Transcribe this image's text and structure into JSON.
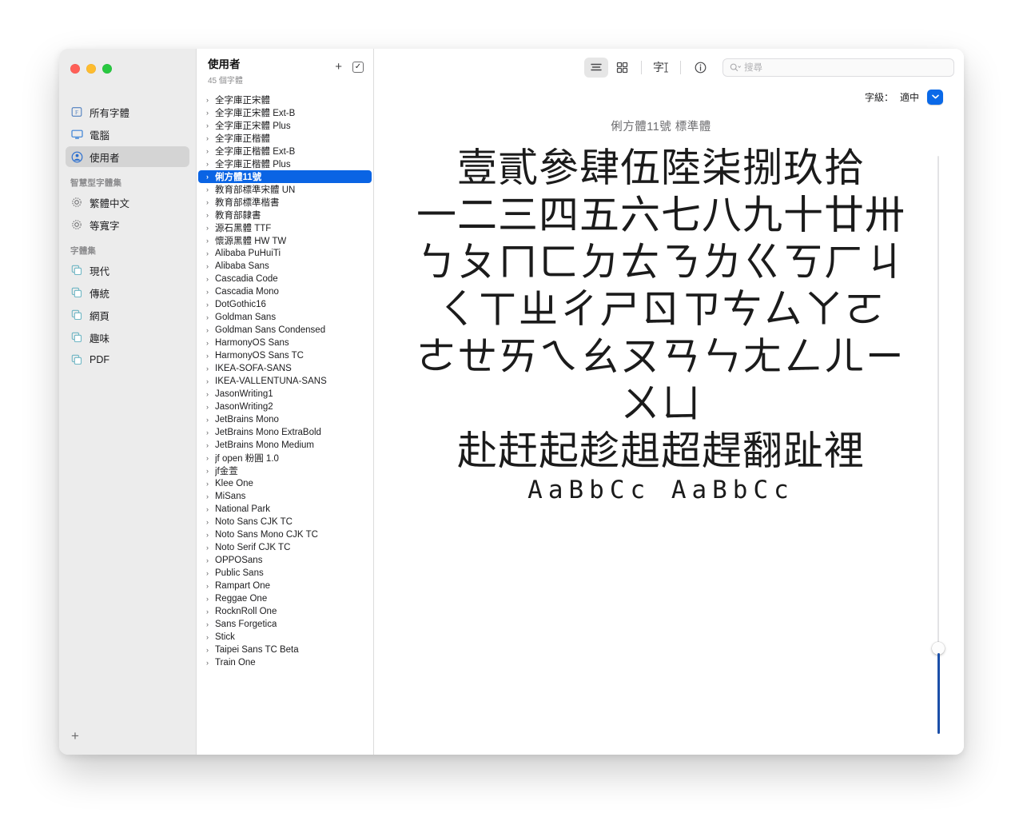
{
  "window": {
    "traffic_lights": [
      "close",
      "minimize",
      "zoom"
    ]
  },
  "sidebar": {
    "items": [
      {
        "label": "所有字體",
        "icon": "all-fonts-icon"
      },
      {
        "label": "電腦",
        "icon": "computer-icon"
      },
      {
        "label": "使用者",
        "icon": "user-icon",
        "selected": true
      }
    ],
    "smart_group_label": "智慧型字體集",
    "smart_items": [
      {
        "label": "繁體中文",
        "icon": "gear-icon"
      },
      {
        "label": "等寬字",
        "icon": "gear-icon"
      }
    ],
    "collections_group_label": "字體集",
    "collections": [
      {
        "label": "現代",
        "icon": "collection-icon"
      },
      {
        "label": "傳統",
        "icon": "collection-icon"
      },
      {
        "label": "網頁",
        "icon": "collection-icon"
      },
      {
        "label": "趣味",
        "icon": "collection-icon"
      },
      {
        "label": "PDF",
        "icon": "collection-icon"
      }
    ],
    "add_button_label": "+"
  },
  "font_list": {
    "title": "使用者",
    "subtitle": "45 個字體",
    "add_label": "+",
    "select_all_label": "✓",
    "selected_font": "俐方體11號",
    "fonts": [
      "全字庫正宋體",
      "全字庫正宋體 Ext-B",
      "全字庫正宋體 Plus",
      "全字庫正楷體",
      "全字庫正楷體 Ext-B",
      "全字庫正楷體 Plus",
      "俐方體11號",
      "教育部標準宋體 UN",
      "教育部標準楷書",
      "教育部隸書",
      "源石黑體 TTF",
      "懷源黑體 HW TW",
      "Alibaba PuHuiTi",
      "Alibaba Sans",
      "Cascadia Code",
      "Cascadia Mono",
      "DotGothic16",
      "Goldman Sans",
      "Goldman Sans Condensed",
      "HarmonyOS Sans",
      "HarmonyOS Sans TC",
      "IKEA-SOFA-SANS",
      "IKEA-VALLENTUNA-SANS",
      "JasonWriting1",
      "JasonWriting2",
      "JetBrains Mono",
      "JetBrains Mono ExtraBold",
      "JetBrains Mono Medium",
      "jf open 粉圓 1.0",
      "jf金萱",
      "Klee One",
      "MiSans",
      "National Park",
      "Noto Sans CJK TC",
      "Noto Sans Mono CJK TC",
      "Noto Serif CJK TC",
      "OPPOSans",
      "Public Sans",
      "Rampart One",
      "Reggae One",
      "RocknRoll One",
      "Sans Forgetica",
      "Stick",
      "Taipei Sans TC Beta",
      "Train One"
    ]
  },
  "toolbar": {
    "view_list_icon": "list-view-icon",
    "view_grid_icon": "grid-view-icon",
    "sample_text_icon": "sample-text-icon",
    "sample_text_glyph": "字",
    "info_icon": "info-icon",
    "search": {
      "placeholder": "搜尋",
      "value": "",
      "icon": "search-icon"
    }
  },
  "size_control": {
    "label": "字級：",
    "value": "適中",
    "popup_icon": "chevron-down-icon",
    "accent_color": "#0a69e8"
  },
  "specimen": {
    "title": "俐方體11號 標準體",
    "lines": [
      "壹貳參肆伍陸柒捌玖拾",
      "一二三四五六七八九十廿卅",
      "ㄅㄆㄇㄈㄉㄊㄋㄌㄍㄎㄏㄐ",
      "ㄑㄒㄓㄔㄕㄖㄗㄘㄙㄚㄛ",
      "ㄜㄝㄞㄟㄠㄡㄢㄣㄤㄥㄦㄧ",
      "ㄨㄩ",
      "赴赶起趁趄超趕翻趾裡"
    ],
    "latin_line": "AaBbCc AaBbCc"
  },
  "size_slider": {
    "name": "font-size-slider",
    "track_color": "#1b4fa8"
  }
}
